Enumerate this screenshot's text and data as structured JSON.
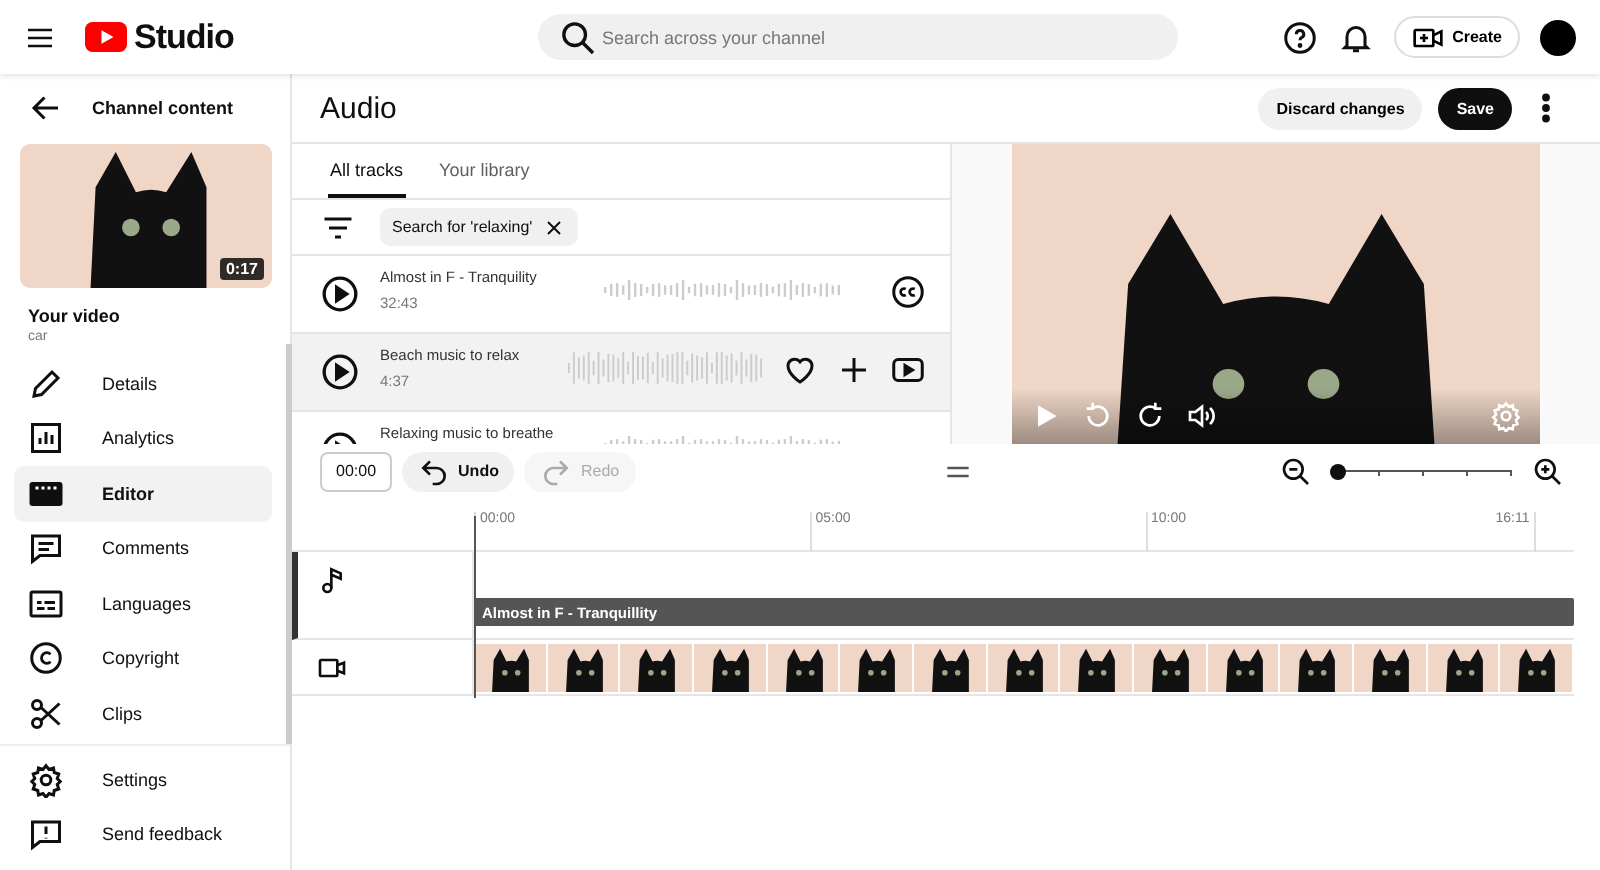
{
  "header": {
    "logo_text": "Studio",
    "search": {
      "placeholder": "Search across your channel"
    },
    "create_label": "Create"
  },
  "sidebar": {
    "back_label": "Channel content",
    "video": {
      "duration": "0:17",
      "title": "Your video",
      "subtitle": "car"
    },
    "items": [
      {
        "label": "Details",
        "selected": false
      },
      {
        "label": "Analytics",
        "selected": false
      },
      {
        "label": "Editor",
        "selected": true
      },
      {
        "label": "Comments",
        "selected": false
      },
      {
        "label": "Languages",
        "selected": false
      },
      {
        "label": "Copyright",
        "selected": false
      },
      {
        "label": "Clips",
        "selected": false
      }
    ],
    "footer_items": [
      {
        "label": "Settings"
      },
      {
        "label": "Send feedback"
      }
    ]
  },
  "editor": {
    "title": "Audio",
    "discard_label": "Discard changes",
    "save_label": "Save",
    "tabs": [
      {
        "label": "All tracks",
        "selected": true
      },
      {
        "label": "Your library",
        "selected": false
      }
    ],
    "filter_chip": "Search for 'relaxing'",
    "tracks": [
      {
        "title": "Almost in F - Tranquility",
        "duration": "32:43",
        "selected": false,
        "captions": true
      },
      {
        "title": "Beach music to relax",
        "duration": "4:37",
        "selected": true,
        "captions": false
      },
      {
        "title": "Relaxing music to breathe",
        "selected": false,
        "captions": false
      }
    ]
  },
  "timeline": {
    "time": "00:00",
    "undo_label": "Undo",
    "redo_label": "Redo",
    "redo_disabled": true,
    "zoom": {
      "level": 0
    },
    "ruler": [
      "00:00",
      "05:00",
      "10:00",
      "16:11"
    ],
    "audio_clip": "Almost in F - Tranquillity"
  }
}
